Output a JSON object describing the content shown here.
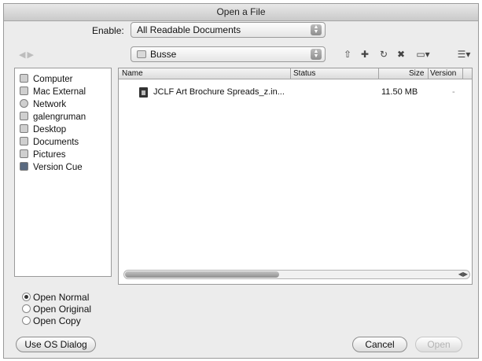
{
  "window": {
    "title": "Open a File"
  },
  "enable": {
    "label": "Enable:",
    "value": "All Readable Documents"
  },
  "location": {
    "value": "Busse"
  },
  "toolbar": {
    "icons": [
      "back-arrow-icon",
      "forward-arrow-icon",
      "go-up-folder-icon",
      "new-folder-icon",
      "refresh-icon",
      "delete-icon",
      "view-menu-icon",
      "list-view-icon"
    ]
  },
  "sidebar": {
    "items": [
      {
        "label": "Computer",
        "icon": "computer-icon"
      },
      {
        "label": "Mac External",
        "icon": "drive-icon"
      },
      {
        "label": "Network",
        "icon": "network-icon"
      },
      {
        "label": "galengruman",
        "icon": "home-icon"
      },
      {
        "label": "Desktop",
        "icon": "desktop-icon"
      },
      {
        "label": "Documents",
        "icon": "documents-icon"
      },
      {
        "label": "Pictures",
        "icon": "pictures-icon"
      },
      {
        "label": "Version Cue",
        "icon": "version-cue-icon"
      }
    ]
  },
  "filelist": {
    "columns": [
      "Name",
      "Status",
      "Size",
      "Version"
    ],
    "rows": [
      {
        "name": "JCLF Art Brochure Spreads_z.in...",
        "status": "",
        "size": "11.50 MB",
        "version": "-"
      }
    ]
  },
  "open_options": [
    {
      "label": "Open Normal",
      "selected": true
    },
    {
      "label": "Open Original",
      "selected": false
    },
    {
      "label": "Open Copy",
      "selected": false
    }
  ],
  "buttons": {
    "os_dialog": "Use OS Dialog",
    "cancel": "Cancel",
    "open": "Open"
  }
}
